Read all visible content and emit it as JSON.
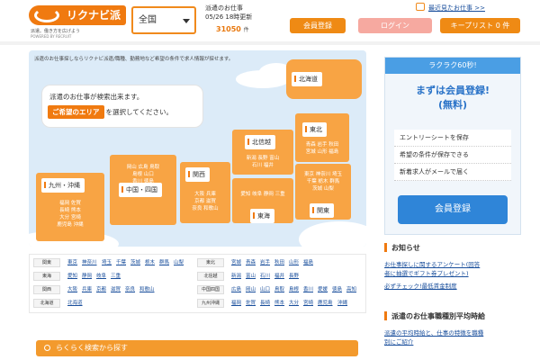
{
  "header": {
    "logo_text": "リクナビ派遣",
    "tagline": "派遣。働き方を広げよう",
    "powered": "POWERED BY RECRUIT",
    "area_select": "全国",
    "update_label": "派遣のお仕事",
    "update_time": "05/26 18時更新",
    "count": "31050",
    "count_unit": "件",
    "recent_link": "最近見たお仕事 >>",
    "register_button": "会員登録",
    "login_button": "ログイン",
    "keeplist_button": "キープリスト 0 件"
  },
  "map": {
    "subtitle": "派遣のお仕事探しならリクナビ派遣/職種、勤務地など希望の条件で求人情報が探せます。",
    "bubble_line1": "派遣のお仕事が検索出来ます。",
    "bubble_highlight": "ご希望のエリア",
    "bubble_line2": "を選択してください。",
    "regions": [
      {
        "name": "北海道"
      },
      {
        "name": "東北",
        "prefs": "青森 岩手 秋田\n宮城 山形 福島"
      },
      {
        "name": "北信越",
        "prefs": "新潟 長野 富山\n石川 福井"
      },
      {
        "name": "関東",
        "prefs": "東京 神奈川 埼玉\n千葉 栃木 群馬\n茨城 山梨"
      },
      {
        "name": "東海",
        "prefs": "愛知 岐阜 静岡 三重"
      },
      {
        "name": "関西",
        "prefs": "大阪 兵庫\n京都 滋賀\n奈良 和歌山"
      },
      {
        "name": "中国・四国",
        "prefs": "岡山 広島 鳥取\n島根 山口\n香川 徳島\n愛媛 高知"
      },
      {
        "name": "九州・沖縄",
        "prefs": "福岡 佐賀\n長崎 熊本\n大分 宮崎\n鹿児島 沖縄"
      }
    ]
  },
  "area_table": {
    "left": [
      {
        "region": "関東",
        "prefs": [
          "東京",
          "神奈川",
          "埼玉",
          "千葉",
          "茨城",
          "栃木",
          "群馬",
          "山梨"
        ]
      },
      {
        "region": "東海",
        "prefs": [
          "愛知",
          "静岡",
          "岐阜",
          "三重"
        ]
      },
      {
        "region": "関西",
        "prefs": [
          "大阪",
          "兵庫",
          "京都",
          "滋賀",
          "奈良",
          "和歌山"
        ]
      },
      {
        "region": "北海道",
        "prefs": [
          "北海道"
        ]
      }
    ],
    "right": [
      {
        "region": "東北",
        "prefs": [
          "宮城",
          "青森",
          "岩手",
          "秋田",
          "山形",
          "福島"
        ]
      },
      {
        "region": "北信越",
        "prefs": [
          "新潟",
          "富山",
          "石川",
          "福井",
          "長野"
        ]
      },
      {
        "region": "中国四国",
        "prefs": [
          "広島",
          "岡山",
          "山口",
          "鳥取",
          "島根",
          "香川",
          "愛媛",
          "徳島",
          "高知"
        ]
      },
      {
        "region": "九州沖縄",
        "prefs": [
          "福岡",
          "佐賀",
          "長崎",
          "熊本",
          "大分",
          "宮崎",
          "鹿児島",
          "沖縄"
        ]
      }
    ]
  },
  "search_bar": "らくらく検索から探す",
  "promo": {
    "badge": "ラクラク60秒!",
    "title1": "まずは会員登録!",
    "title2": "(無料)",
    "items": [
      "エントリーシートを保存",
      "希望の条件が保存できる",
      "新着求人がメールで届く"
    ],
    "button": "会員登録"
  },
  "notice": {
    "title": "お知らせ",
    "links": [
      "お仕事探しに関するアンケート(回答",
      "者に抽選でギフト券プレゼント)",
      "必ずチェック!最低賃金制度"
    ]
  },
  "wage": {
    "title": "派遣のお仕事職種別平均時給",
    "links": [
      "派遣の平均時給と、仕事の特徴を職種",
      "別にご紹介"
    ]
  },
  "colors": {
    "brand": "#f07a10",
    "region": "#f8a444",
    "accent_blue": "#2f85d8",
    "link": "#1a4f9c"
  }
}
